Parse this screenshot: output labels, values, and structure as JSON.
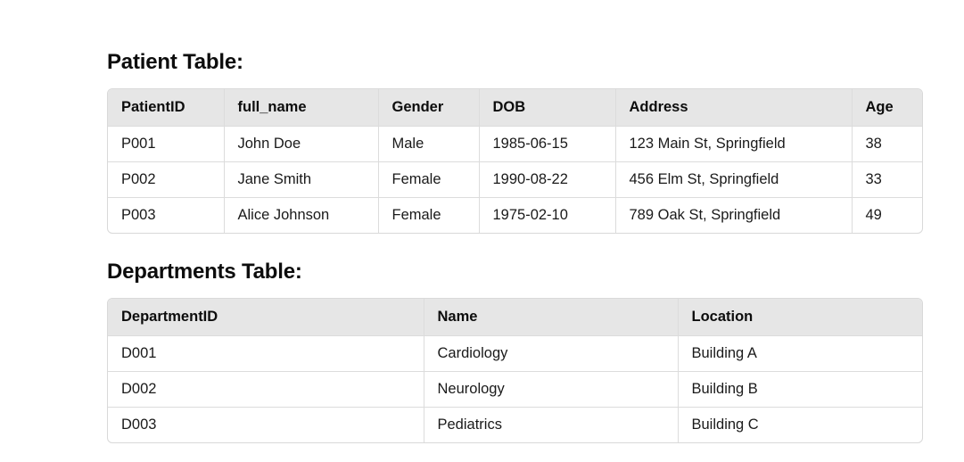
{
  "patient_section": {
    "title": "Patient Table:",
    "headers": [
      "PatientID",
      "full_name",
      "Gender",
      "DOB",
      "Address",
      "Age"
    ],
    "rows": [
      [
        "P001",
        "John Doe",
        "Male",
        "1985-06-15",
        "123 Main St, Springfield",
        "38"
      ],
      [
        "P002",
        "Jane Smith",
        "Female",
        "1990-08-22",
        "456 Elm St, Springfield",
        "33"
      ],
      [
        "P003",
        "Alice Johnson",
        "Female",
        "1975-02-10",
        "789 Oak St, Springfield",
        "49"
      ]
    ]
  },
  "departments_section": {
    "title": "Departments Table:",
    "headers": [
      "DepartmentID",
      "Name",
      "Location"
    ],
    "rows": [
      [
        "D001",
        "Cardiology",
        "Building A"
      ],
      [
        "D002",
        "Neurology",
        "Building B"
      ],
      [
        "D003",
        "Pediatrics",
        "Building C"
      ]
    ]
  }
}
